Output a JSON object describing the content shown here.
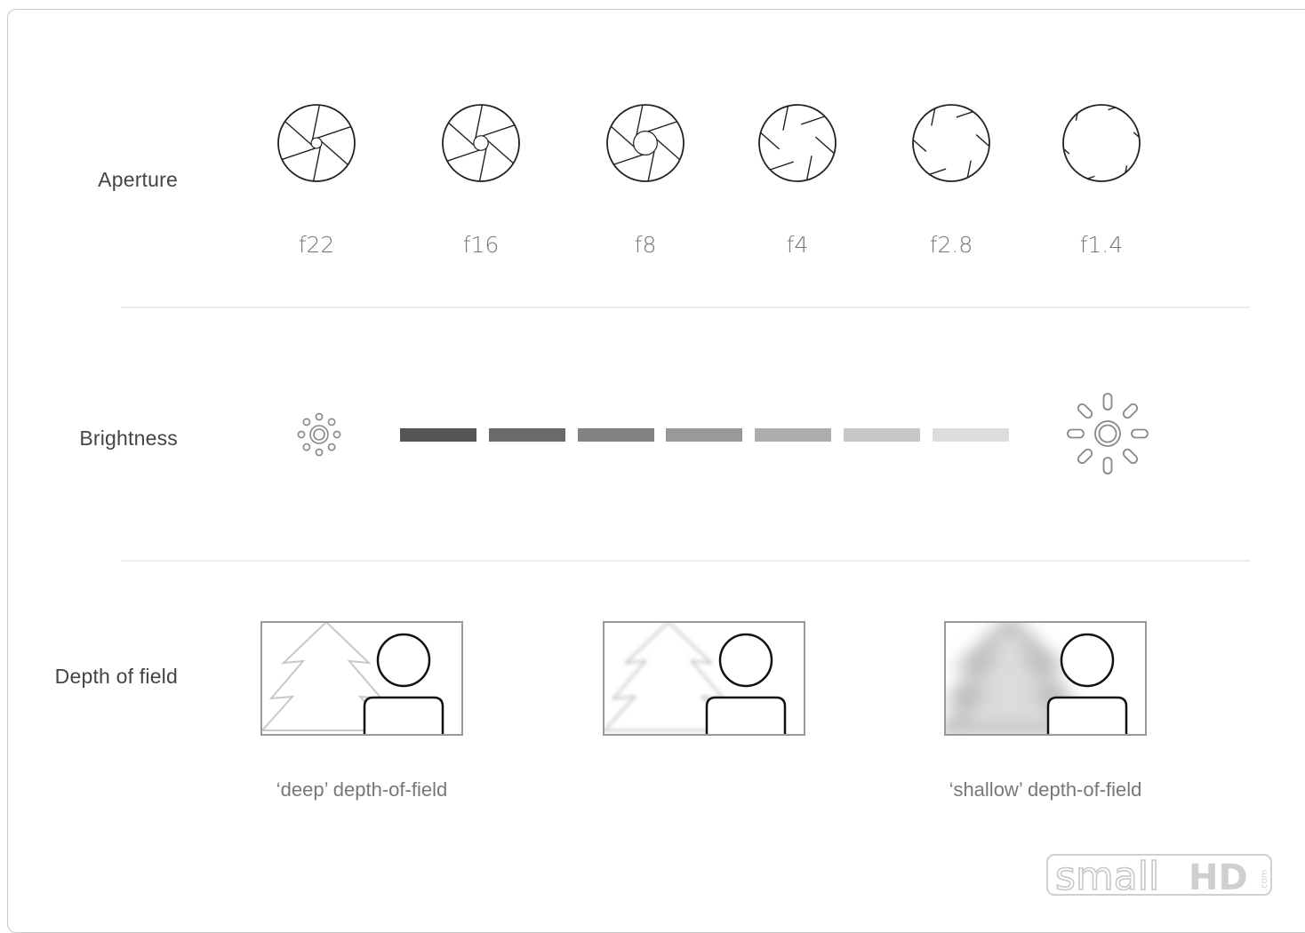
{
  "rows": {
    "aperture": {
      "label": "Aperture",
      "stops": [
        {
          "label": "f22",
          "opening": 0.08
        },
        {
          "label": "f16",
          "opening": 0.14
        },
        {
          "label": "f8",
          "opening": 0.28
        },
        {
          "label": "f4",
          "opening": 0.5
        },
        {
          "label": "f2.8",
          "opening": 0.72
        },
        {
          "label": "f1.4",
          "opening": 0.95
        }
      ]
    },
    "brightness": {
      "label": "Brightness",
      "dim_icon": "dim-sun-icon",
      "bright_icon": "bright-sun-icon",
      "scale_colors": [
        "#555555",
        "#6a6a6a",
        "#828282",
        "#999999",
        "#adadad",
        "#c6c6c6",
        "#dcdcdc"
      ]
    },
    "depth_of_field": {
      "label": "Depth of field",
      "scenes": [
        {
          "blur": 0,
          "caption": "‘deep’ depth-of-field"
        },
        {
          "blur": 2,
          "caption": ""
        },
        {
          "blur": 9,
          "caption": "‘shallow’ depth-of-field"
        }
      ]
    }
  },
  "logo": {
    "text_light": "small",
    "text_bold": "HD",
    "text_small": ".com"
  }
}
